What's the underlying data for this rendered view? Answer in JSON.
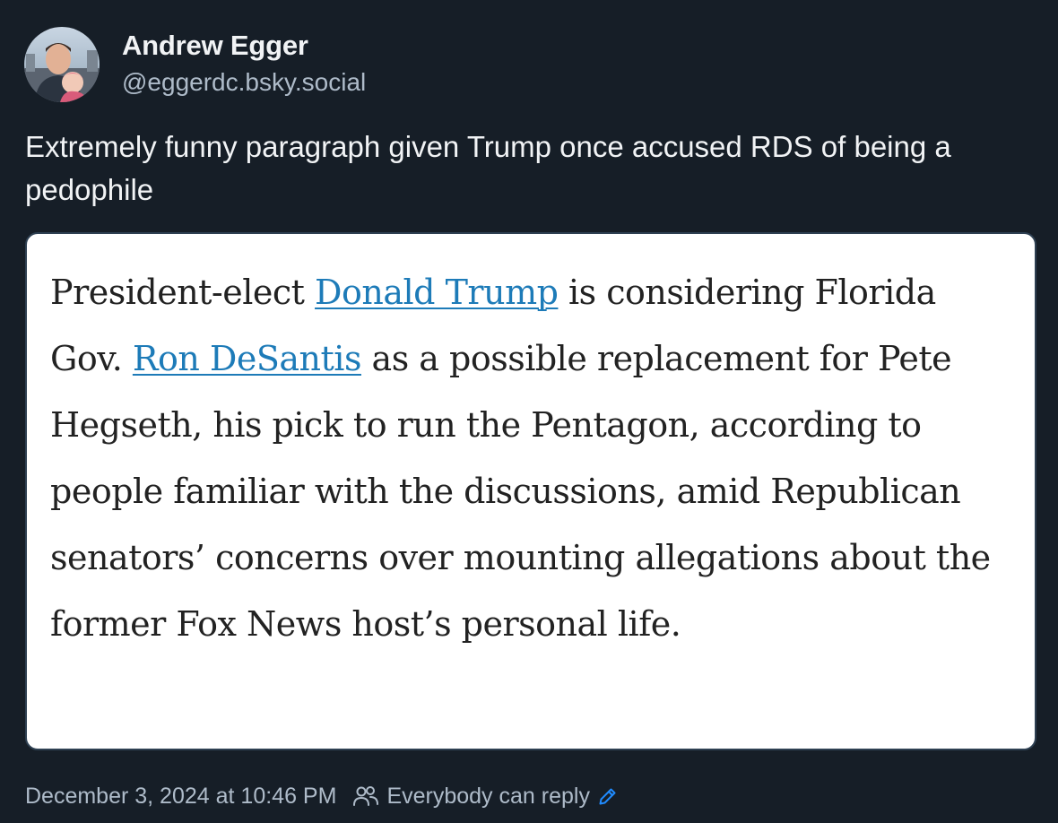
{
  "author": {
    "display_name": "Andrew Egger",
    "handle": "@eggerdc.bsky.social",
    "avatar_icon": "avatar-photo"
  },
  "post": {
    "text": "Extremely funny paragraph given Trump once accused RDS of being a pedophile"
  },
  "embed": {
    "segments": [
      {
        "text": "President-elect ",
        "link": false
      },
      {
        "text": "Donald Trump",
        "link": true
      },
      {
        "text": " is considering Florida Gov. ",
        "link": false
      },
      {
        "text": "Ron DeSantis",
        "link": true
      },
      {
        "text": " as a possible replacement for Pete Hegseth, his pick to run the Pentagon, according to people familiar with the discussions, amid Republican senators’ concerns over mounting allegations about the former Fox News host’s personal life.",
        "link": false
      }
    ],
    "link_color": "#1d7bb8"
  },
  "footer": {
    "timestamp": "December 3, 2024 at 10:46 PM",
    "reply_setting": "Everybody can reply",
    "people_icon": "people-icon",
    "edit_icon": "pencil-icon",
    "accent_color": "#208bfe"
  }
}
